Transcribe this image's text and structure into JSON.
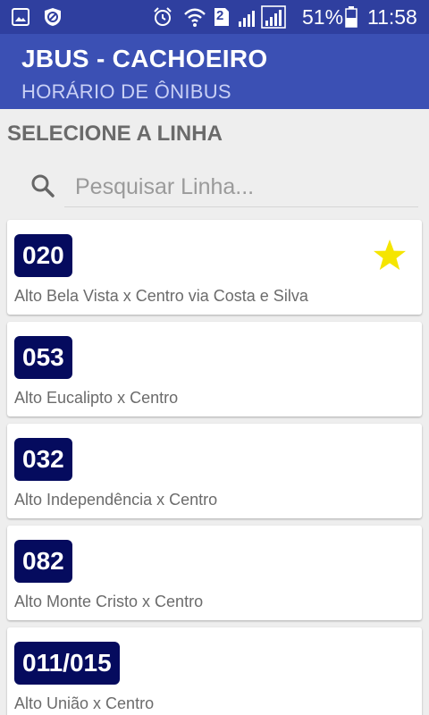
{
  "status_bar": {
    "battery": "51%",
    "time": "11:58",
    "sim_slot": "2",
    "icons": [
      "gallery-icon",
      "block-icon",
      "alarm-icon",
      "wifi-icon",
      "sim-2-icon",
      "signal-icon",
      "signal-icon",
      "battery-icon"
    ]
  },
  "app_bar": {
    "title": "JBUS - CACHOEIRO",
    "subtitle": "HORÁRIO DE ÔNIBUS",
    "color": "#3b50b4"
  },
  "section": {
    "title": "SELECIONE A LINHA"
  },
  "search": {
    "placeholder": "Pesquisar Linha...",
    "value": ""
  },
  "lines": [
    {
      "number": "020",
      "route": "Alto Bela Vista x Centro via Costa e Silva",
      "favorite": true
    },
    {
      "number": "053",
      "route": "Alto Eucalipto x Centro",
      "favorite": false
    },
    {
      "number": "032",
      "route": "Alto Independência x Centro",
      "favorite": false
    },
    {
      "number": "082",
      "route": "Alto Monte Cristo x Centro",
      "favorite": false
    },
    {
      "number": "011/015",
      "route": "Alto União x Centro",
      "favorite": false
    }
  ],
  "colors": {
    "badge": "#050b5e",
    "star": "#f5e500",
    "status_bar": "#2f3f9f"
  }
}
